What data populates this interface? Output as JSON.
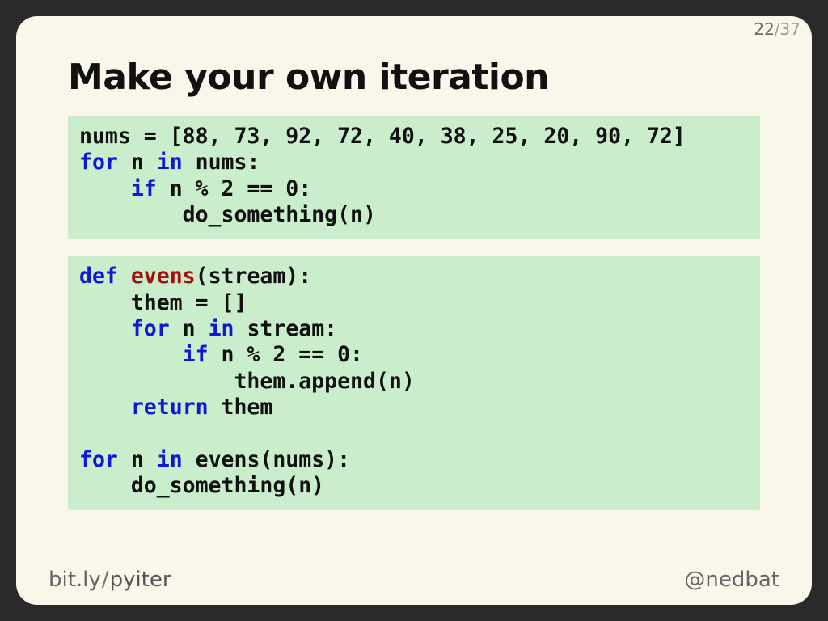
{
  "slide": {
    "current": "22",
    "total": "37",
    "title": "Make your own iteration"
  },
  "code1": {
    "l1a": "nums = [",
    "l1_nums": "88, 73, 92, 72, 40, 38, 25, 20, 90, 72",
    "l1b": "]",
    "for": "for",
    "in": "in",
    "if": "if",
    "l2a": " n ",
    "l2b": " nums:",
    "l3a": "    ",
    "l3b": " n % 2 == 0:",
    "l4": "        do_something(n)"
  },
  "code2": {
    "def": "def",
    "fn": "evens",
    "l1b": "(stream):",
    "l2": "    them = []",
    "for": "for",
    "in": "in",
    "if": "if",
    "return": "return",
    "l3a": "    ",
    "l3b": " n ",
    "l3c": " stream:",
    "l4a": "        ",
    "l4b": " n % 2 == 0:",
    "l5": "            them.append(n)",
    "l6a": "    ",
    "l6b": " them",
    "blank": "",
    "l8a": " n ",
    "l8b": " evens(nums):",
    "l9": "    do_something(n)"
  },
  "footer": {
    "left_host": "bit.ly",
    "left_slash": "/",
    "left_path": "pyiter",
    "right": "@nedbat"
  }
}
